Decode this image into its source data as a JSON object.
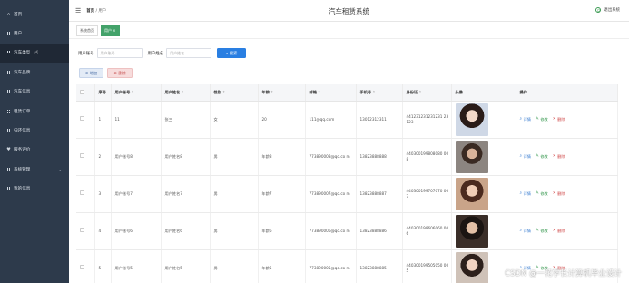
{
  "header": {
    "title": "汽车租赁系统",
    "breadcrumb_home": "首页",
    "breadcrumb_sep": "/",
    "breadcrumb_current": "用户",
    "logout_label": "退出系统"
  },
  "sidebar": {
    "items": [
      {
        "label": "首页",
        "icon": "home-icon"
      },
      {
        "label": "用户",
        "icon": "user-icon"
      },
      {
        "label": "汽车类型",
        "icon": "grid-icon",
        "active": true
      },
      {
        "label": "汽车品牌",
        "icon": "grid-icon"
      },
      {
        "label": "汽车信息",
        "icon": "grid-icon"
      },
      {
        "label": "租赁订单",
        "icon": "grid-icon"
      },
      {
        "label": "归还信息",
        "icon": "grid-icon"
      },
      {
        "label": "服务评价",
        "icon": "pin-icon"
      },
      {
        "label": "系统管理",
        "icon": "grid-icon",
        "expandable": true
      },
      {
        "label": "我的信息",
        "icon": "grid-icon",
        "expandable": true
      }
    ]
  },
  "tabs": [
    {
      "label": "系统首页"
    },
    {
      "label": "用户 ×",
      "active": true
    }
  ],
  "search": {
    "account_label": "用户账号",
    "account_placeholder": "用户账号",
    "name_label": "用户姓名",
    "name_placeholder": "用户姓名",
    "button_label": "搜索"
  },
  "actions": {
    "add_label": "增加",
    "delete_label": "删除"
  },
  "table": {
    "columns": [
      "",
      "序号",
      "用户账号",
      "用户姓名",
      "性别",
      "年龄",
      "邮箱",
      "手机号",
      "身份证",
      "头像",
      "操作"
    ],
    "rows": [
      {
        "index": "1",
        "account": "11",
        "name": "张三",
        "gender": "女",
        "age": "20",
        "email": "111@qq.com",
        "phone": "13012312311",
        "id_card": "441231231231231 23123"
      },
      {
        "index": "2",
        "account": "用户账号8",
        "name": "用户姓名8",
        "gender": "男",
        "age": "年龄8",
        "email": "773890008@qq.co m",
        "phone": "13823888888",
        "id_card": "440300199808080 008"
      },
      {
        "index": "3",
        "account": "用户账号7",
        "name": "用户姓名7",
        "gender": "男",
        "age": "年龄7",
        "email": "773890007@qq.co m",
        "phone": "13823888887",
        "id_card": "440300199707070 007"
      },
      {
        "index": "4",
        "account": "用户账号6",
        "name": "用户姓名6",
        "gender": "男",
        "age": "年龄6",
        "email": "773890006@qq.co m",
        "phone": "13823888886",
        "id_card": "440300199606060 006"
      },
      {
        "index": "5",
        "account": "用户账号5",
        "name": "用户姓名5",
        "gender": "男",
        "age": "年龄5",
        "email": "773890005@qq.co m",
        "phone": "13823888885",
        "id_card": "440300199505050 005"
      }
    ],
    "op_detail": "详情",
    "op_edit": "修改",
    "op_delete": "删除"
  },
  "watermark": "CSDN @一花学长计算机毕业设计"
}
